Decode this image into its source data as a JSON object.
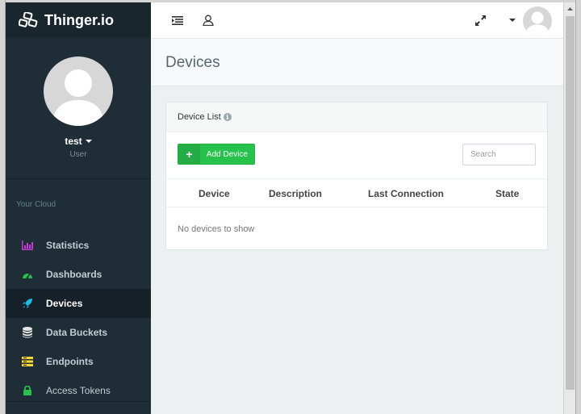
{
  "brand": {
    "name": "Thinger.io"
  },
  "user": {
    "name": "test",
    "role": "User"
  },
  "sidebar": {
    "section_label": "Your Cloud",
    "items": [
      {
        "label": "Statistics",
        "icon": "bar-chart-icon",
        "color": "#c73ad9"
      },
      {
        "label": "Dashboards",
        "icon": "gauge-icon",
        "color": "#27c24c"
      },
      {
        "label": "Devices",
        "icon": "rocket-icon",
        "color": "#23b7e5",
        "active": true
      },
      {
        "label": "Data Buckets",
        "icon": "database-icon",
        "color": "#e6e6e6"
      },
      {
        "label": "Endpoints",
        "icon": "endpoints-icon",
        "color": "#fad733"
      },
      {
        "label": "Access Tokens",
        "icon": "lock-icon",
        "color": "#27c24c"
      }
    ]
  },
  "page": {
    "title": "Devices"
  },
  "panel": {
    "heading": "Device List",
    "add_button_label": "Add Device",
    "search_placeholder": "Search",
    "columns": [
      "Device",
      "Description",
      "Last Connection",
      "State"
    ],
    "empty_text": "No devices to show"
  },
  "colors": {
    "sidebar_bg": "#1f2d36",
    "accent_green": "#27c24c",
    "main_bg": "#edf0f1"
  }
}
